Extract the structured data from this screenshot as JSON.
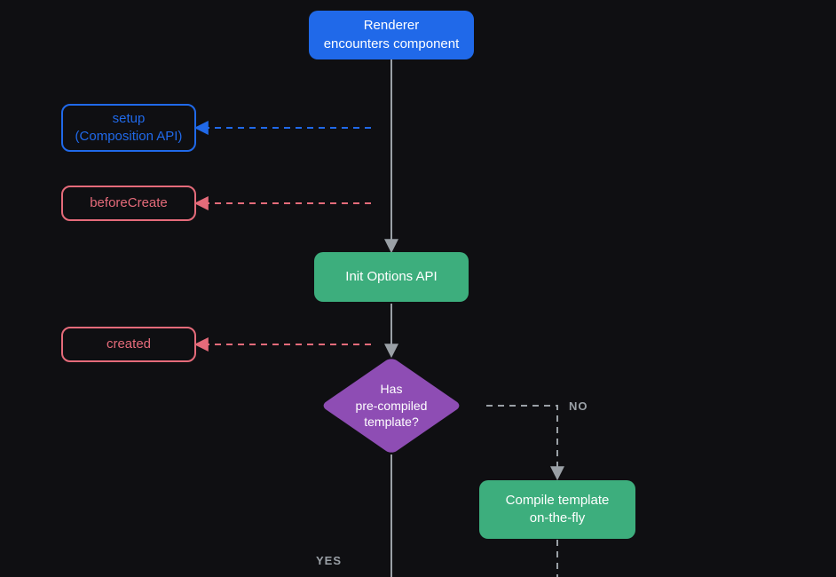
{
  "nodes": {
    "renderer": {
      "line1": "Renderer",
      "line2": "encounters component"
    },
    "setup": {
      "line1": "setup",
      "line2": "(Composition API)"
    },
    "beforeCreate": {
      "label": "beforeCreate"
    },
    "initOptions": {
      "label": "Init Options API"
    },
    "created": {
      "label": "created"
    },
    "decision": {
      "line1": "Has",
      "line2": "pre-compiled",
      "line3": "template?"
    },
    "compile": {
      "line1": "Compile template",
      "line2": "on-the-fly"
    }
  },
  "labels": {
    "yes": "YES",
    "no": "NO"
  },
  "colors": {
    "blue": "#2069e9",
    "green": "#3dae7d",
    "purple": "#8e4db4",
    "red": "#e56b7a",
    "grey": "#9aa0a6"
  }
}
